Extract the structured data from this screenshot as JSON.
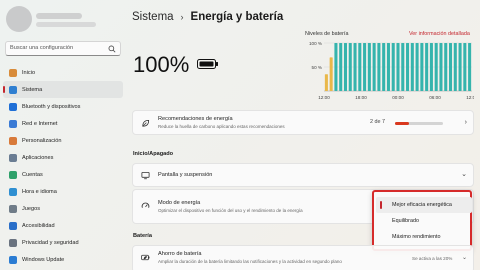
{
  "sidebar": {
    "search_placeholder": "Buscar una configuración",
    "items": [
      {
        "label": "Inicio",
        "icon": "home-icon",
        "color": "#d88c3a"
      },
      {
        "label": "Sistema",
        "icon": "monitor-icon",
        "color": "#2f7fd1",
        "active": true
      },
      {
        "label": "Bluetooth y dispositivos",
        "icon": "bluetooth-icon",
        "color": "#1f6fd6"
      },
      {
        "label": "Red e Internet",
        "icon": "wifi-icon",
        "color": "#3a7bd5"
      },
      {
        "label": "Personalización",
        "icon": "brush-icon",
        "color": "#d87a3a"
      },
      {
        "label": "Aplicaciones",
        "icon": "apps-icon",
        "color": "#6a7d93"
      },
      {
        "label": "Cuentas",
        "icon": "person-icon",
        "color": "#2ea06a"
      },
      {
        "label": "Hora e idioma",
        "icon": "globe-icon",
        "color": "#2f8fd1"
      },
      {
        "label": "Juegos",
        "icon": "gamepad-icon",
        "color": "#6f7c88"
      },
      {
        "label": "Accesibilidad",
        "icon": "accessibility-icon",
        "color": "#2a6fc9"
      },
      {
        "label": "Privacidad y seguridad",
        "icon": "shield-icon",
        "color": "#6a7380"
      },
      {
        "label": "Windows Update",
        "icon": "update-icon",
        "color": "#2b7cd3"
      }
    ]
  },
  "header": {
    "breadcrumb_parent": "Sistema",
    "separator": "›",
    "title": "Energía y batería"
  },
  "battery": {
    "percent": "100%"
  },
  "levels": {
    "title": "Niveles de batería",
    "details_link": "Ver información detallada"
  },
  "chart_data": {
    "type": "bar",
    "title": "Niveles de batería",
    "y_ticks": [
      "100 %",
      "50 %"
    ],
    "x_ticks": [
      "12:00",
      "18:00",
      "00:00",
      "06:00",
      "12:00"
    ],
    "ylim": [
      0,
      100
    ],
    "values": [
      35,
      70,
      100,
      100,
      100,
      100,
      100,
      100,
      100,
      100,
      100,
      100,
      100,
      100,
      100,
      100,
      100,
      100,
      100,
      100,
      100,
      100,
      100,
      100,
      100,
      100,
      100,
      100,
      100,
      100,
      100
    ],
    "low_bar_color": "#e9b84a",
    "bar_color": "#35b4ad"
  },
  "recommendations": {
    "title": "Recomendaciones de energía",
    "subtitle": "Reduce la huella de carbono aplicando estas recomendaciones",
    "progress_text": "2 de 7",
    "progress_fraction": 0.2857,
    "chevron": "›"
  },
  "sections": {
    "power": "Inicio/Apagado",
    "battery": "Batería"
  },
  "screen_sleep": {
    "title": "Pantalla y suspensión",
    "chevron": "⌄"
  },
  "power_mode": {
    "title": "Modo de energía",
    "subtitle": "Optimizar el dispositivo en función del uso y el rendimiento de la energía",
    "options": [
      "Mejor eficacia energética",
      "Equilibrado",
      "Máximo rendimiento"
    ],
    "selected_index": 0,
    "caret": "⌄"
  },
  "battery_saver": {
    "title": "Ahorro de batería",
    "subtitle": "Ampliar la duración de la batería limitando las notificaciones y la actividad en segundo plano",
    "status": "Se activa a las 20%",
    "chevron": "⌄"
  },
  "colors": {
    "accent": "#c4262e",
    "dropdown_highlight": "#d62b2b"
  }
}
